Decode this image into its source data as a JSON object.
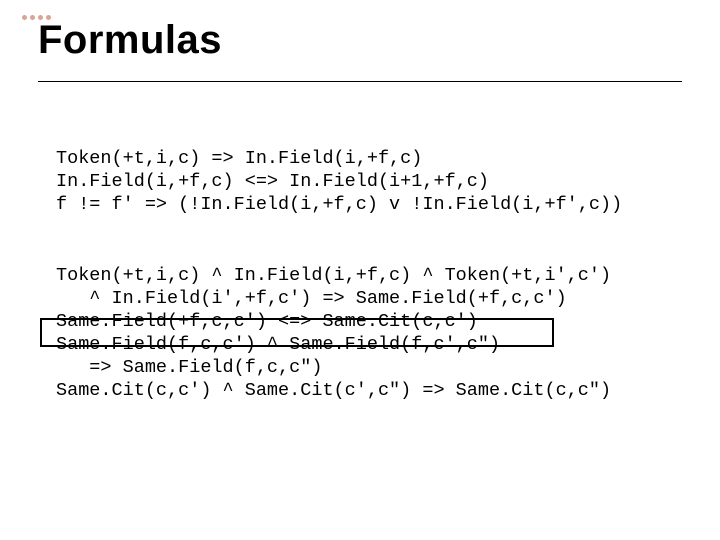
{
  "title": "Formulas",
  "block1": {
    "l1": "Token(+t,i,c) => In.Field(i,+f,c)",
    "l2": "In.Field(i,+f,c) <=> In.Field(i+1,+f,c)",
    "l3": "f != f' => (!In.Field(i,+f,c) v !In.Field(i,+f',c))"
  },
  "block2": {
    "l1": "Token(+t,i,c) ^ In.Field(i,+f,c) ^ Token(+t,i',c')",
    "l2": "   ^ In.Field(i',+f,c') => Same.Field(+f,c,c')",
    "l3": "Same.Field(+f,c,c') <=> Same.Cit(c,c')",
    "l4": "Same.Field(f,c,c') ^ Same.Field(f,c',c\")",
    "l5": "   => Same.Field(f,c,c\")",
    "l6": "Same.Cit(c,c') ^ Same.Cit(c',c\") => Same.Cit(c,c\")"
  }
}
